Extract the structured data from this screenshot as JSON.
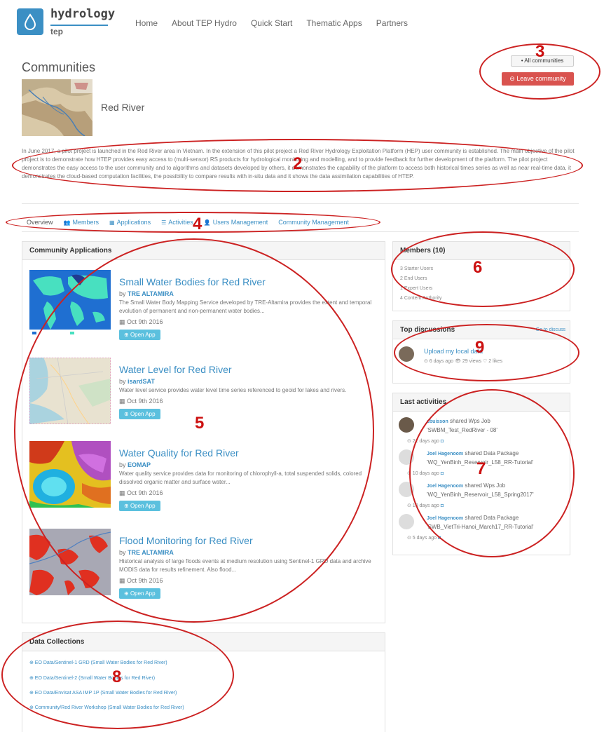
{
  "header": {
    "logo_title": "hydrology",
    "logo_sub": "tep",
    "nav": [
      "Home",
      "About TEP Hydro",
      "Quick Start",
      "Thematic Apps",
      "Partners"
    ]
  },
  "page": {
    "title": "Communities",
    "all_communities": "• All communities",
    "leave_community": "⊖ Leave community",
    "community_name": "Red River",
    "description": "In June 2017, a pilot project is launched in the Red River area in Vietnam. In the extension of this pilot project a Red River Hydrology Exploitation Platform (HEP) user community is established. The main objective of the pilot project is to demonstrate how HTEP provides easy access to (multi-sensor) RS products for hydrological monitoring and modelling, and to provide feedback for further development of the platform. The pilot project demonstrates the easy access to the user community and to algorithms and datasets developed by others, it demonstrates the capability of the platform to access both historical times series as well as near real-time data, it demonstrates the cloud-based computation facilities, the possibility to compare results with in-situ data and it shows the data assimilation capabilities of HTEP."
  },
  "tabs": [
    {
      "icon": "",
      "label": "Overview"
    },
    {
      "icon": "👥",
      "label": "Members"
    },
    {
      "icon": "▦",
      "label": "Applications"
    },
    {
      "icon": "☰",
      "label": "Activities"
    },
    {
      "icon": "👤",
      "label": "Users Management"
    },
    {
      "icon": "",
      "label": "Community Management"
    }
  ],
  "apps_panel": {
    "title": "Community Applications",
    "apps": [
      {
        "title": "Small Water Bodies for Red River",
        "by": "by",
        "author": "TRE ALTAMIRA",
        "desc": "The Small Water Body Mapping Service developed by TRE-Altamira provides the extent and temporal evolution of permanent and non-permanent water bodies...",
        "date": "Oct 9th 2016",
        "button": "Open App"
      },
      {
        "title": "Water Level for Red River",
        "by": "by",
        "author": "isardSAT",
        "desc": "Water level service provides water level time series referenced to geoid for lakes and rivers.",
        "date": "Oct 9th 2016",
        "button": "Open App"
      },
      {
        "title": "Water Quality for Red River",
        "by": "by",
        "author": "EOMAP",
        "desc": "Water quality service provides data for monitoring of chlorophyll-a, total suspended solids, colored dissolved organic matter and surface water...",
        "date": "Oct 9th 2016",
        "button": "Open App"
      },
      {
        "title": "Flood Monitoring for Red River",
        "by": "by",
        "author": "TRE ALTAMIRA",
        "desc": "Historical analysis of large floods events at medium resolution using Sentinel-1 GRD data and archive MODIS data for results refinement. Also flood...",
        "date": "Oct 9th 2016",
        "button": "Open App"
      }
    ]
  },
  "members": {
    "title": "Members (10)",
    "lines": [
      "3 Starter Users",
      "2 End Users",
      "1 Expert Users",
      "4 Content Authority"
    ]
  },
  "discussions": {
    "title": "Top discussions",
    "link": "Go to discuss",
    "topic": "Upload my local data",
    "meta": "⊙ 6 days ago   👁 29 views   ♡ 2 likes"
  },
  "activities": {
    "title": "Last activities",
    "items": [
      {
        "user": "cbuisson",
        "action": "shared Wps Job",
        "target": "'SWBM_Test_RedRiver - 08'",
        "time": "⊙ 21 days ago"
      },
      {
        "user": "Joel Hagenoom",
        "action": "shared Data Package",
        "target": "'WQ_YenBinh_Reservoir_L58_RR-Tutorial'",
        "time": "⊙ 10 days ago"
      },
      {
        "user": "Joel Hagenoom",
        "action": "shared Wps Job",
        "target": "'WQ_YenBinh_Reservoir_L58_Spring2017'",
        "time": "⊙ 10 days ago"
      },
      {
        "user": "Joel Hagenoom",
        "action": "shared Data Package",
        "target": "'SWB_VietTri-Hanoi_March17_RR-Tutorial'",
        "time": "⊙ 5 days ago"
      }
    ]
  },
  "collections": {
    "title": "Data Collections",
    "items": [
      "⊕ EO Data/Sentinel-1 GRD (Small Water Bodies for Red River)",
      "⊕ EO Data/Sentinel-2 (Small Water Bodies for Red River)",
      "⊕ EO Data/Envisat ASA IMP 1P (Small Water Bodies for Red River)",
      "⊕ Community/Red River Workshop (Small Water Bodies for Red River)"
    ]
  },
  "annotations": [
    "2",
    "3",
    "4",
    "5",
    "6",
    "7",
    "8",
    "9"
  ],
  "colors": {
    "accent": "#3b8fc4",
    "danger": "#d9534f",
    "info": "#5bc0de",
    "annotation": "#cc2222"
  }
}
